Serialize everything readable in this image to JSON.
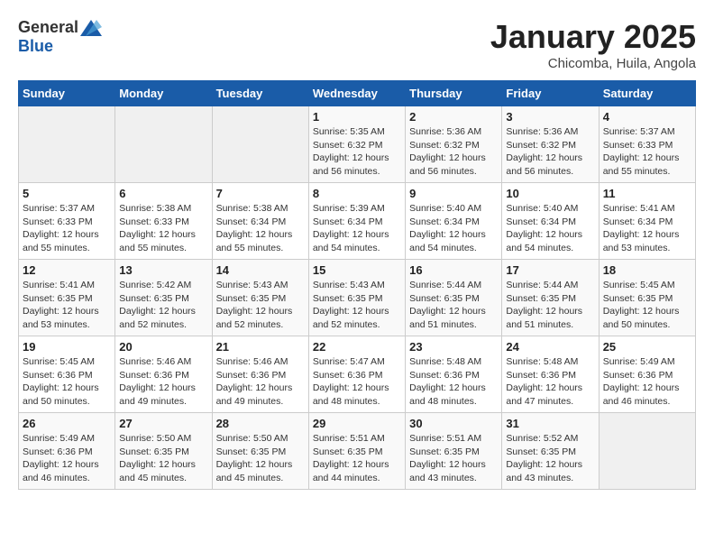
{
  "header": {
    "logo_general": "General",
    "logo_blue": "Blue",
    "month_title": "January 2025",
    "location": "Chicomba, Huila, Angola"
  },
  "calendar": {
    "days_of_week": [
      "Sunday",
      "Monday",
      "Tuesday",
      "Wednesday",
      "Thursday",
      "Friday",
      "Saturday"
    ],
    "weeks": [
      [
        {
          "day": "",
          "info": ""
        },
        {
          "day": "",
          "info": ""
        },
        {
          "day": "",
          "info": ""
        },
        {
          "day": "1",
          "info": "Sunrise: 5:35 AM\nSunset: 6:32 PM\nDaylight: 12 hours\nand 56 minutes."
        },
        {
          "day": "2",
          "info": "Sunrise: 5:36 AM\nSunset: 6:32 PM\nDaylight: 12 hours\nand 56 minutes."
        },
        {
          "day": "3",
          "info": "Sunrise: 5:36 AM\nSunset: 6:32 PM\nDaylight: 12 hours\nand 56 minutes."
        },
        {
          "day": "4",
          "info": "Sunrise: 5:37 AM\nSunset: 6:33 PM\nDaylight: 12 hours\nand 55 minutes."
        }
      ],
      [
        {
          "day": "5",
          "info": "Sunrise: 5:37 AM\nSunset: 6:33 PM\nDaylight: 12 hours\nand 55 minutes."
        },
        {
          "day": "6",
          "info": "Sunrise: 5:38 AM\nSunset: 6:33 PM\nDaylight: 12 hours\nand 55 minutes."
        },
        {
          "day": "7",
          "info": "Sunrise: 5:38 AM\nSunset: 6:34 PM\nDaylight: 12 hours\nand 55 minutes."
        },
        {
          "day": "8",
          "info": "Sunrise: 5:39 AM\nSunset: 6:34 PM\nDaylight: 12 hours\nand 54 minutes."
        },
        {
          "day": "9",
          "info": "Sunrise: 5:40 AM\nSunset: 6:34 PM\nDaylight: 12 hours\nand 54 minutes."
        },
        {
          "day": "10",
          "info": "Sunrise: 5:40 AM\nSunset: 6:34 PM\nDaylight: 12 hours\nand 54 minutes."
        },
        {
          "day": "11",
          "info": "Sunrise: 5:41 AM\nSunset: 6:34 PM\nDaylight: 12 hours\nand 53 minutes."
        }
      ],
      [
        {
          "day": "12",
          "info": "Sunrise: 5:41 AM\nSunset: 6:35 PM\nDaylight: 12 hours\nand 53 minutes."
        },
        {
          "day": "13",
          "info": "Sunrise: 5:42 AM\nSunset: 6:35 PM\nDaylight: 12 hours\nand 52 minutes."
        },
        {
          "day": "14",
          "info": "Sunrise: 5:43 AM\nSunset: 6:35 PM\nDaylight: 12 hours\nand 52 minutes."
        },
        {
          "day": "15",
          "info": "Sunrise: 5:43 AM\nSunset: 6:35 PM\nDaylight: 12 hours\nand 52 minutes."
        },
        {
          "day": "16",
          "info": "Sunrise: 5:44 AM\nSunset: 6:35 PM\nDaylight: 12 hours\nand 51 minutes."
        },
        {
          "day": "17",
          "info": "Sunrise: 5:44 AM\nSunset: 6:35 PM\nDaylight: 12 hours\nand 51 minutes."
        },
        {
          "day": "18",
          "info": "Sunrise: 5:45 AM\nSunset: 6:35 PM\nDaylight: 12 hours\nand 50 minutes."
        }
      ],
      [
        {
          "day": "19",
          "info": "Sunrise: 5:45 AM\nSunset: 6:36 PM\nDaylight: 12 hours\nand 50 minutes."
        },
        {
          "day": "20",
          "info": "Sunrise: 5:46 AM\nSunset: 6:36 PM\nDaylight: 12 hours\nand 49 minutes."
        },
        {
          "day": "21",
          "info": "Sunrise: 5:46 AM\nSunset: 6:36 PM\nDaylight: 12 hours\nand 49 minutes."
        },
        {
          "day": "22",
          "info": "Sunrise: 5:47 AM\nSunset: 6:36 PM\nDaylight: 12 hours\nand 48 minutes."
        },
        {
          "day": "23",
          "info": "Sunrise: 5:48 AM\nSunset: 6:36 PM\nDaylight: 12 hours\nand 48 minutes."
        },
        {
          "day": "24",
          "info": "Sunrise: 5:48 AM\nSunset: 6:36 PM\nDaylight: 12 hours\nand 47 minutes."
        },
        {
          "day": "25",
          "info": "Sunrise: 5:49 AM\nSunset: 6:36 PM\nDaylight: 12 hours\nand 46 minutes."
        }
      ],
      [
        {
          "day": "26",
          "info": "Sunrise: 5:49 AM\nSunset: 6:36 PM\nDaylight: 12 hours\nand 46 minutes."
        },
        {
          "day": "27",
          "info": "Sunrise: 5:50 AM\nSunset: 6:35 PM\nDaylight: 12 hours\nand 45 minutes."
        },
        {
          "day": "28",
          "info": "Sunrise: 5:50 AM\nSunset: 6:35 PM\nDaylight: 12 hours\nand 45 minutes."
        },
        {
          "day": "29",
          "info": "Sunrise: 5:51 AM\nSunset: 6:35 PM\nDaylight: 12 hours\nand 44 minutes."
        },
        {
          "day": "30",
          "info": "Sunrise: 5:51 AM\nSunset: 6:35 PM\nDaylight: 12 hours\nand 43 minutes."
        },
        {
          "day": "31",
          "info": "Sunrise: 5:52 AM\nSunset: 6:35 PM\nDaylight: 12 hours\nand 43 minutes."
        },
        {
          "day": "",
          "info": ""
        }
      ]
    ]
  }
}
